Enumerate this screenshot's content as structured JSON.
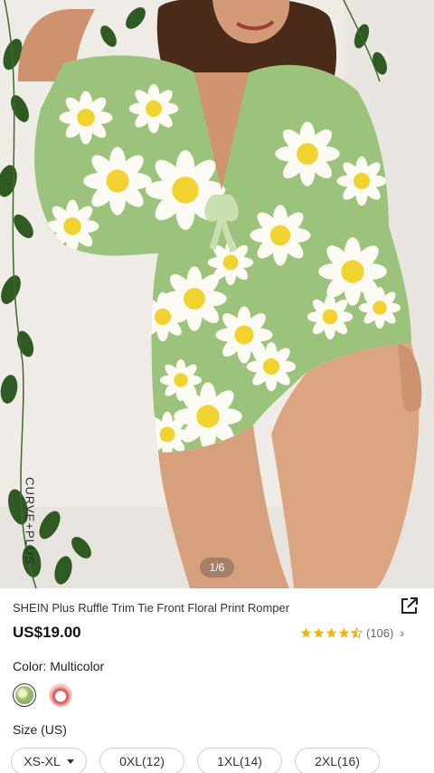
{
  "gallery": {
    "pager_text": "1/6",
    "watermark": "CURVE+PLUS"
  },
  "product": {
    "title": "SHEIN Plus Ruffle Trim Tie Front Floral Print Romper",
    "price": "US$19.00",
    "rating": 4.5,
    "review_count": "(106)",
    "share_icon": "share-icon"
  },
  "color": {
    "label": "Color: Multicolor",
    "swatches": [
      "green-daisy-floral",
      "red-white-floral"
    ]
  },
  "size": {
    "label": "Size (US)",
    "options": [
      {
        "label": "XS-XL"
      },
      {
        "label": "0XL(12)"
      },
      {
        "label": "1XL(14)"
      },
      {
        "label": "2XL(16)"
      }
    ]
  },
  "colors": {
    "star": "#f5b300",
    "romper_green": "#9cc37c",
    "daisy_yellow": "#f3d735"
  }
}
